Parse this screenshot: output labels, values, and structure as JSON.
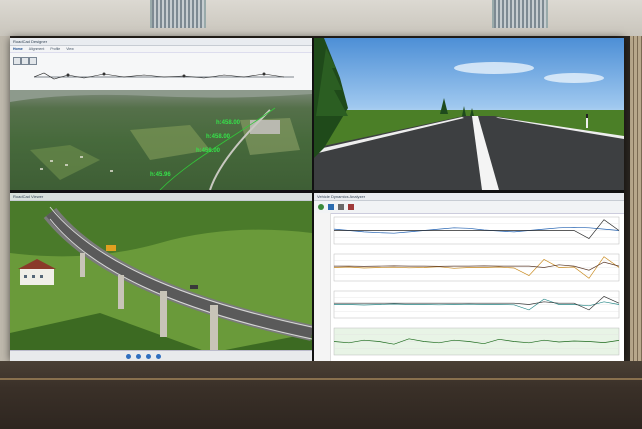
{
  "room": {
    "left_wall_color": "#bfb9ad",
    "floor_color": "#3a3028"
  },
  "tl_window": {
    "title": "RoadCad Designer",
    "tabs": [
      {
        "label": "Home",
        "active": true
      },
      {
        "label": "Alignment",
        "active": false
      },
      {
        "label": "Profile",
        "active": false
      },
      {
        "label": "View",
        "active": false
      }
    ],
    "labels_3d": [
      "h:45.96",
      "h:458.00",
      "h:458.00",
      "h:458.00"
    ],
    "label_color": "#36e04a"
  },
  "tr_view": {
    "description_icons": [
      "tree-icon",
      "road-marker-icon"
    ]
  },
  "bl_window": {
    "title": "RoadCad Viewer",
    "media_controls": [
      "rewind-icon",
      "play-icon",
      "stop-icon",
      "forward-icon"
    ]
  },
  "br_window": {
    "title": "Vehicle Dynamics Analyzer",
    "chart_data": [
      {
        "type": "line",
        "title": "",
        "series": [
          {
            "color": "#1f5fb0",
            "values": [
              0.55,
              0.5,
              0.45,
              0.42,
              0.4,
              0.45,
              0.5,
              0.55,
              0.6,
              0.58,
              0.52,
              0.48,
              0.45,
              0.5,
              0.55,
              0.6,
              0.62,
              0.6,
              0.55,
              0.5
            ]
          },
          {
            "color": "#2a2a2a",
            "values": [
              0.5,
              0.5,
              0.5,
              0.5,
              0.5,
              0.5,
              0.5,
              0.5,
              0.5,
              0.5,
              0.5,
              0.5,
              0.5,
              0.5,
              0.5,
              0.5,
              0.5,
              0.2,
              0.9,
              0.5
            ]
          }
        ]
      },
      {
        "type": "line",
        "series": [
          {
            "color": "#c98a1e",
            "values": [
              0.5,
              0.52,
              0.48,
              0.5,
              0.51,
              0.49,
              0.5,
              0.53,
              0.47,
              0.5,
              0.5,
              0.52,
              0.48,
              0.2,
              0.8,
              0.5,
              0.52,
              0.1,
              0.9,
              0.5
            ]
          },
          {
            "color": "#5b3a2a",
            "values": [
              0.55,
              0.55,
              0.54,
              0.55,
              0.56,
              0.55,
              0.55,
              0.54,
              0.55,
              0.55,
              0.56,
              0.55,
              0.55,
              0.55,
              0.5,
              0.6,
              0.55,
              0.4,
              0.7,
              0.55
            ]
          }
        ]
      },
      {
        "type": "line",
        "series": [
          {
            "color": "#2a8a8a",
            "values": [
              0.5,
              0.5,
              0.48,
              0.5,
              0.52,
              0.5,
              0.5,
              0.49,
              0.5,
              0.51,
              0.5,
              0.5,
              0.49,
              0.3,
              0.7,
              0.5,
              0.5,
              0.45,
              0.6,
              0.5
            ]
          },
          {
            "color": "#333333",
            "values": [
              0.55,
              0.55,
              0.55,
              0.55,
              0.55,
              0.55,
              0.55,
              0.55,
              0.55,
              0.55,
              0.55,
              0.55,
              0.55,
              0.5,
              0.6,
              0.55,
              0.55,
              0.3,
              0.8,
              0.55
            ]
          }
        ]
      },
      {
        "type": "line",
        "series": [
          {
            "color": "#1c6b1c",
            "values": [
              0.5,
              0.45,
              0.55,
              0.5,
              0.4,
              0.6,
              0.5,
              0.45,
              0.55,
              0.5,
              0.42,
              0.58,
              0.5,
              0.45,
              0.55,
              0.48,
              0.52,
              0.5,
              0.46,
              0.54
            ]
          }
        ]
      }
    ]
  }
}
